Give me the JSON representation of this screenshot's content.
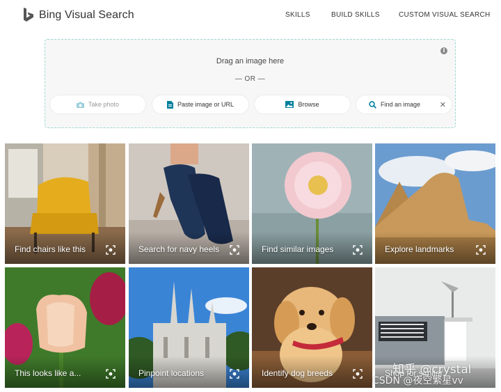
{
  "header": {
    "brand": "Bing Visual Search",
    "nav": [
      "SKILLS",
      "BUILD SKILLS",
      "CUSTOM VISUAL SEARCH"
    ]
  },
  "dropzone": {
    "drag_text": "Drag an image here",
    "or_text": "— OR —",
    "buttons": {
      "take_photo": "Take photo",
      "paste": "Paste image or URL",
      "browse": "Browse"
    },
    "find_input_placeholder": "Find an image"
  },
  "tiles": [
    {
      "label": "Find chairs like this"
    },
    {
      "label": "Search for navy heels"
    },
    {
      "label": "Find similar images"
    },
    {
      "label": "Explore landmarks"
    },
    {
      "label": "This looks like a..."
    },
    {
      "label": "Pinpoint locations"
    },
    {
      "label": "Identify dog breeds"
    },
    {
      "label": "Shop for similar..."
    }
  ],
  "watermark": {
    "line1": "知乎 @crystal",
    "line2": "CSDN @夜空繁星vv"
  },
  "colors": {
    "dropzone_border": "#9fd8d2",
    "accent_icon": "#00809d"
  }
}
